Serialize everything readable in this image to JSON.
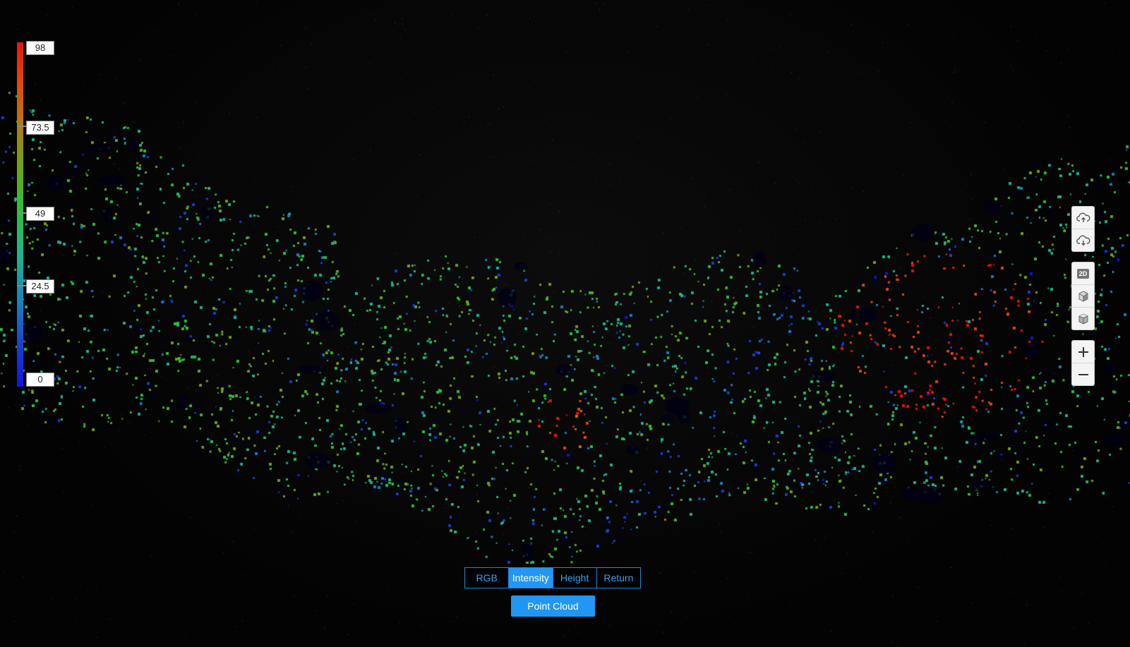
{
  "legend": {
    "labels": [
      "98",
      "73.5",
      "49",
      "24.5",
      "0"
    ]
  },
  "colors": {
    "accent": "#2196f3",
    "legend_top": "#e8140c",
    "legend_bottom": "#1414e0"
  },
  "toolbar": {
    "upload_icon": "cloud-upload-icon",
    "download_icon": "cloud-download-icon",
    "view_2d_label": "2D",
    "view_3d_icon": "cube-icon",
    "view_3d_alt_icon": "cube-perspective-icon",
    "zoom_in_icon": "plus-icon",
    "zoom_out_icon": "minus-icon"
  },
  "color_modes": {
    "options": [
      "RGB",
      "Intensity",
      "Height",
      "Return"
    ],
    "selected": "Intensity"
  },
  "point_cloud_button": "Point Cloud"
}
